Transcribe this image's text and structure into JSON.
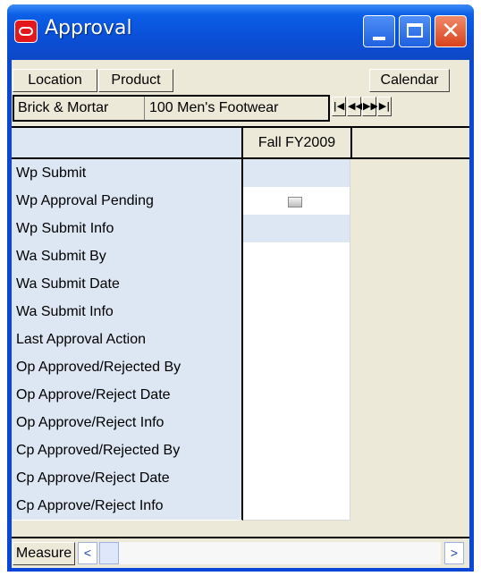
{
  "window": {
    "title": "Approval",
    "close_glyph": "✕"
  },
  "toolbar": {
    "location_label": "Location",
    "product_label": "Product",
    "calendar_label": "Calendar"
  },
  "dimensions": {
    "location_value": "Brick & Mortar",
    "product_value": "100 Men's Footwear",
    "nav": {
      "first": "|◀",
      "prev": "◀◀",
      "next": "▶▶",
      "last": "▶|"
    }
  },
  "grid": {
    "column_header": "Fall FY2009",
    "rows": [
      {
        "label": "Wp Submit",
        "readonly": true
      },
      {
        "label": "Wp Approval Pending",
        "readonly": false,
        "checkbox": true
      },
      {
        "label": "Wp Submit Info",
        "readonly": true
      },
      {
        "label": "Wa Submit By",
        "readonly": false
      },
      {
        "label": "Wa Submit Date",
        "readonly": false
      },
      {
        "label": "Wa Submit Info",
        "readonly": false
      },
      {
        "label": "Last Approval Action",
        "readonly": false
      },
      {
        "label": "Op Approved/Rejected By",
        "readonly": false
      },
      {
        "label": "Op Approve/Reject Date",
        "readonly": false
      },
      {
        "label": "Op Approve/Reject Info",
        "readonly": false
      },
      {
        "label": "Cp Approved/Rejected By",
        "readonly": false
      },
      {
        "label": "Cp Approve/Reject Date",
        "readonly": false
      },
      {
        "label": "Cp Approve/Reject Info",
        "readonly": false
      }
    ]
  },
  "footer": {
    "measure_label": "Measure",
    "scroll_left": "<",
    "scroll_right": ">"
  },
  "colors": {
    "title_bar": "#0a4fd6",
    "label_bg": "#dce7f3",
    "chrome": "#ece9d8"
  }
}
